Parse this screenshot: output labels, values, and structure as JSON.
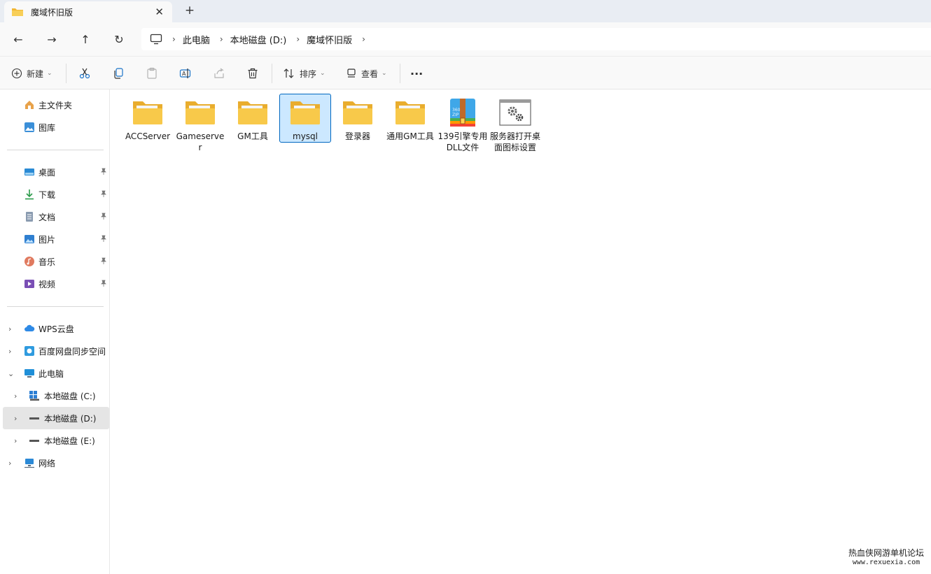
{
  "window": {
    "tab_title": "魔域怀旧版",
    "close_glyph": "✕",
    "new_tab_glyph": "+"
  },
  "nav": {
    "back_glyph": "←",
    "forward_glyph": "→",
    "up_glyph": "↑",
    "refresh_glyph": "↻",
    "chevron": "›",
    "breadcrumbs": [
      "此电脑",
      "本地磁盘 (D:)",
      "魔域怀旧版"
    ]
  },
  "commands": {
    "new_label": "新建",
    "sort_label": "排序",
    "view_label": "查看",
    "more_glyph": "···",
    "dropdown_glyph": "⌄"
  },
  "sidebar": {
    "home": "主文件夹",
    "gallery": "图库",
    "pinned": [
      {
        "label": "桌面",
        "icon": "desktop-icon"
      },
      {
        "label": "下载",
        "icon": "download-icon"
      },
      {
        "label": "文档",
        "icon": "documents-icon"
      },
      {
        "label": "图片",
        "icon": "pictures-icon"
      },
      {
        "label": "音乐",
        "icon": "music-icon"
      },
      {
        "label": "视频",
        "icon": "videos-icon"
      }
    ],
    "pin_glyph": "📌",
    "wps": "WPS云盘",
    "baidu": "百度网盘同步空间",
    "this_pc": "此电脑",
    "drives": [
      "本地磁盘 (C:)",
      "本地磁盘 (D:)",
      "本地磁盘 (E:)"
    ],
    "network": "网络",
    "expand_glyph": "›",
    "collapse_glyph": "⌄"
  },
  "files": [
    {
      "name": "ACCServer",
      "type": "folder"
    },
    {
      "name": "Gameserver",
      "type": "folder"
    },
    {
      "name": "GM工具",
      "type": "folder"
    },
    {
      "name": "mysql",
      "type": "folder"
    },
    {
      "name": "登录器",
      "type": "folder"
    },
    {
      "name": "通用GM工具",
      "type": "folder"
    },
    {
      "name": "139引擎专用DLL文件",
      "type": "zip"
    },
    {
      "name": "服务器打开桌面图标设置",
      "type": "settings"
    }
  ],
  "watermark": {
    "title": "热血侠网游单机论坛",
    "url": "www.rexuexia.com"
  },
  "colors": {
    "folder": "#f8c94a",
    "accent": "#0067c0",
    "selection": "#cce8ff"
  }
}
